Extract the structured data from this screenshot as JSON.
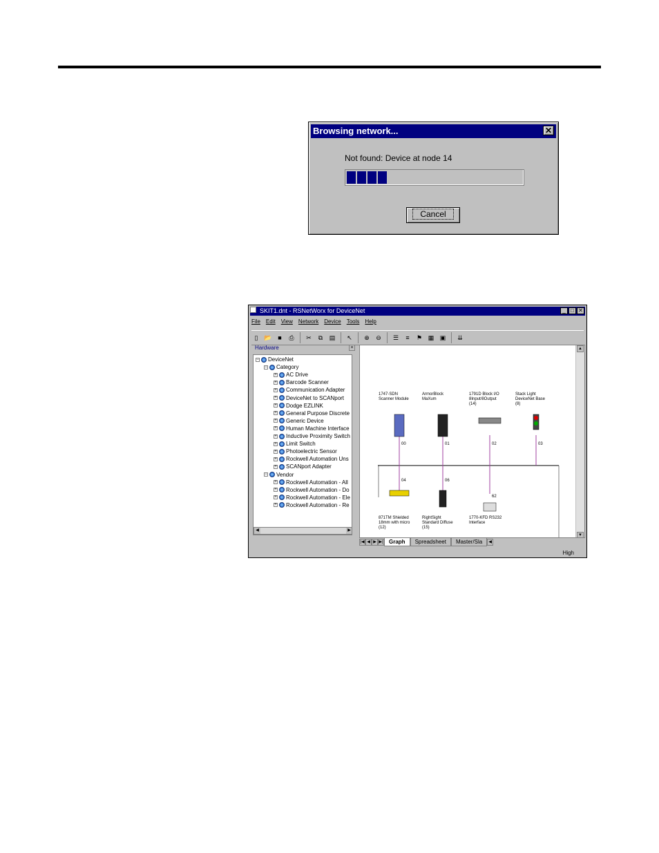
{
  "browse_dialog": {
    "title": "Browsing network...",
    "close": "✕",
    "message": "Not found: Device at node 14",
    "progress_fraction": 0.22,
    "cancel_label": "Cancel"
  },
  "app": {
    "title": "SKIT1.dnt - RSNetWorx for DeviceNet",
    "window_buttons": [
      "_",
      "□",
      "✕"
    ],
    "menu": [
      "File",
      "Edit",
      "View",
      "Network",
      "Device",
      "Tools",
      "Help"
    ],
    "toolbar_icons": [
      "new-icon",
      "open-icon",
      "save-icon",
      "print-icon",
      "cut-icon",
      "copy-icon",
      "paste-icon",
      "pointer-icon",
      "zoom-in-icon",
      "zoom-out-icon",
      "tree-view-icon",
      "list-view-icon",
      "network-icon",
      "browse-icon",
      "properties-icon",
      "download-icon"
    ],
    "hardware_label": "Hardware",
    "tree": {
      "root": "DeviceNet",
      "category_label": "Category",
      "categories": [
        "AC Drive",
        "Barcode Scanner",
        "Communication Adapter",
        "DeviceNet to SCANport",
        "Dodge EZLINK",
        "General Purpose Discrete",
        "Generic Device",
        "Human Machine Interface",
        "Inductive Proximity Switch",
        "Limit Switch",
        "Photoelectric Sensor",
        "Rockwell Automation Uns",
        "SCANport Adapter"
      ],
      "vendor_label": "Vendor",
      "vendors": [
        "Rockwell Automation - All",
        "Rockwell Automation - Do",
        "Rockwell Automation - Ele",
        "Rockwell Automation - Re"
      ]
    },
    "graph": {
      "top_devices": [
        {
          "label": "1747-SDN\nScanner Module",
          "node": "00"
        },
        {
          "label": "ArmorBlock\nMaXum",
          "node": "01"
        },
        {
          "label": "1791D Block I/O\n8Input/8Output\n(14)",
          "node": "02"
        },
        {
          "label": "Stack Light\nDeviceNet Base\n(8)",
          "node": "03"
        }
      ],
      "bottom_devices": [
        {
          "label": "871TM Shielded\n18mm with micro\n(12)",
          "node": "04"
        },
        {
          "label": "RightSight\nStandard Diffuse\n(15)",
          "node": "06"
        },
        {
          "label": "1770-KFD RS232\nInterface",
          "node": "62"
        }
      ]
    },
    "tabs": [
      "Graph",
      "Spreadsheet",
      "Master/Sla"
    ],
    "status": "High"
  }
}
